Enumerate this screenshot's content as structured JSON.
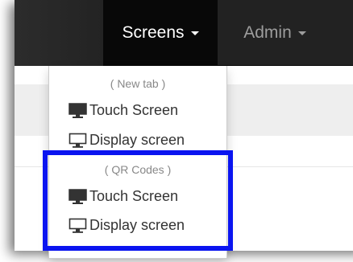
{
  "navbar": {
    "screens_label": "Screens",
    "admin_label": "Admin"
  },
  "dropdown": {
    "new_tab_header": "( New tab )",
    "new_tab_items": [
      "Touch Screen",
      "Display screen"
    ],
    "qr_header": "( QR Codes )",
    "qr_items": [
      "Touch Screen",
      "Display screen"
    ]
  },
  "colors": {
    "navbar_bg": "#222222",
    "active_nav_bg": "#080808",
    "highlight_border": "#0a14f0"
  },
  "icons": {
    "touch": "monitor-icon",
    "display": "monitor-outline-icon"
  }
}
